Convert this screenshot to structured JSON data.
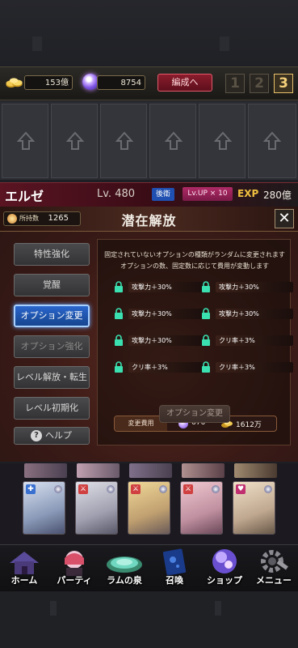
{
  "currency": {
    "gold": "153億",
    "gems": "8754"
  },
  "team": {
    "reorg_label": "編成へ",
    "slots": [
      "1",
      "2",
      "3"
    ],
    "active": "3"
  },
  "character": {
    "name": "エルゼ",
    "level_label": "Lv.",
    "level": "480",
    "position_badge": "後衛",
    "lvup_badge": "Lv.UP × 10",
    "exp_label": "EXP",
    "exp_value": "280億"
  },
  "panel": {
    "holding_label": "所持数",
    "holding_value": "1265",
    "title": "潜在解放",
    "close_label": "✕",
    "menu": [
      {
        "label": "特性強化",
        "state": "normal"
      },
      {
        "label": "覚醒",
        "state": "normal"
      },
      {
        "label": "オプション変更",
        "state": "active"
      },
      {
        "label": "オプション強化",
        "state": "dim"
      },
      {
        "label": "レベル解放・転生",
        "state": "normal"
      },
      {
        "label": "レベル初期化",
        "state": "normal"
      }
    ],
    "help_label": "ヘルプ",
    "description": [
      "固定されていないオプションの種類がランダムに変更されます",
      "オプションの数、固定数に応じて費用が変動します"
    ],
    "options": [
      "攻撃力＋30%",
      "攻撃力＋30%",
      "攻撃力＋30%",
      "攻撃力＋30%",
      "攻撃力＋30%",
      "クリ率＋3%",
      "クリ率＋3%",
      "クリ率＋3%"
    ],
    "cost_label": "変更費用",
    "cost_gems": "676",
    "cost_gold": "1612万",
    "change_button": "オプション変更"
  },
  "nav": [
    "ホーム",
    "パーティ",
    "ラムの泉",
    "召喚",
    "ショップ",
    "メニュー"
  ],
  "colors": {
    "accent_red": "#8a1c2c",
    "active_blue": "#2a66cc",
    "gold": "#f0c040"
  }
}
